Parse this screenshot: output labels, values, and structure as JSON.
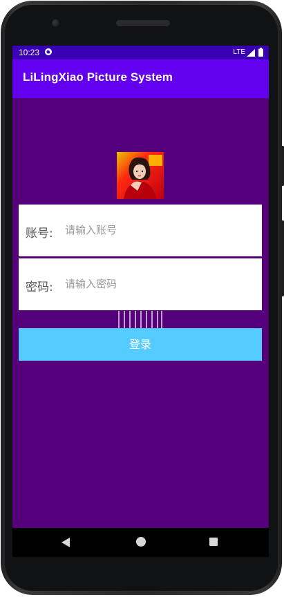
{
  "status_bar": {
    "time": "10:23",
    "network": "LTE",
    "icons": [
      "sync-icon",
      "signal-icon",
      "battery-icon"
    ]
  },
  "app_bar": {
    "title": "LiLingXiao Picture System"
  },
  "login_form": {
    "avatar": "avatar-photo",
    "account": {
      "label": "账号:",
      "value": "",
      "placeholder": "请输入账号"
    },
    "password": {
      "label": "密码:",
      "value": "",
      "placeholder": "请输入密码"
    },
    "login_button_label": "登录"
  },
  "nav_bar": {
    "icons": [
      "back-icon",
      "home-icon",
      "recent-apps-icon"
    ]
  },
  "colors": {
    "screen_background": "#55007a",
    "status_bar": "#3a00b3",
    "app_bar": "#6200ee",
    "login_button": "#55ccff",
    "field_background": "#ffffff"
  }
}
